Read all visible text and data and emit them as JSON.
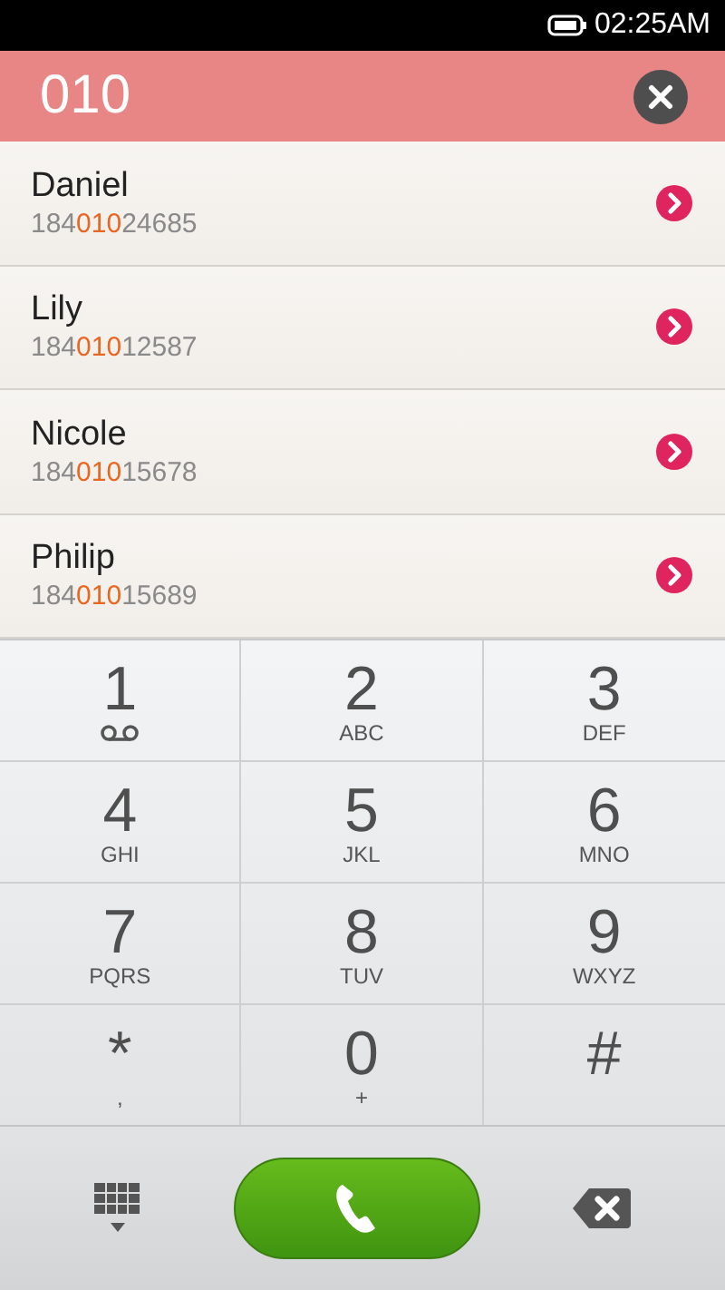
{
  "status_bar": {
    "time": "02:25AM"
  },
  "search": {
    "value": "010"
  },
  "contacts": [
    {
      "name": "Daniel",
      "number_before": "184",
      "number_match": "010",
      "number_after": "24685"
    },
    {
      "name": "Lily",
      "number_before": "184",
      "number_match": "010",
      "number_after": "12587"
    },
    {
      "name": "Nicole",
      "number_before": "184",
      "number_match": "010",
      "number_after": "15678"
    },
    {
      "name": "Philip",
      "number_before": "184",
      "number_match": "010",
      "number_after": "15689"
    }
  ],
  "keys": [
    {
      "digit": "1",
      "kind": "voicemail"
    },
    {
      "digit": "2",
      "kind": "letters",
      "letters": "ABC"
    },
    {
      "digit": "3",
      "kind": "letters",
      "letters": "DEF"
    },
    {
      "digit": "4",
      "kind": "letters",
      "letters": "GHI"
    },
    {
      "digit": "5",
      "kind": "letters",
      "letters": "JKL"
    },
    {
      "digit": "6",
      "kind": "letters",
      "letters": "MNO"
    },
    {
      "digit": "7",
      "kind": "letters",
      "letters": "PQRS"
    },
    {
      "digit": "8",
      "kind": "letters",
      "letters": "TUV"
    },
    {
      "digit": "9",
      "kind": "letters",
      "letters": "WXYZ"
    },
    {
      "digit": "*",
      "kind": "letters",
      "letters": ","
    },
    {
      "digit": "0",
      "kind": "letters",
      "letters": "+"
    },
    {
      "digit": "#",
      "kind": "plain"
    }
  ]
}
